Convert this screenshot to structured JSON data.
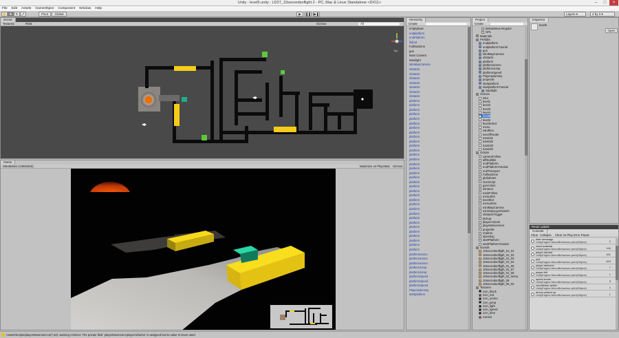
{
  "window": {
    "title": "Unity - level5.unity - LD27_10secondsoflight 2 - PC, Mac & Linux Standalone <DX11>"
  },
  "menu": [
    "File",
    "Edit",
    "Assets",
    "GameObject",
    "Component",
    "Window",
    "Help"
  ],
  "toolbar": {
    "pivot": "Pivot",
    "global": "Global",
    "layers": "Layers",
    "layout": "2 by 3"
  },
  "scene": {
    "tab": "Scene",
    "shading": "Textured",
    "mode": "RGB",
    "gizmos": "Gizmos",
    "search": "All",
    "persp": "Top"
  },
  "game": {
    "tab": "Game",
    "aspect": "Standalone (1360x816)",
    "maximize": "Maximize on Play",
    "stats": "Stats",
    "gizmos": "Gizmos"
  },
  "hierarchy": {
    "tab": "Hierarchy",
    "create": "Create",
    "items": [
      {
        "label": "emptyBase",
        "blue": false
      },
      {
        "label": "endplatform",
        "blue": true
      },
      {
        "label": "endPlatform",
        "blue": true
      },
      {
        "label": "fallout",
        "blue": true
      },
      {
        "label": "FallOutZone",
        "blue": false
      },
      {
        "label": "gun",
        "blue": false
      },
      {
        "label": "Main Camera",
        "blue": false
      },
      {
        "label": "Mainlight",
        "blue": false
      },
      {
        "label": "MiniMapCamera",
        "blue": true
      },
      {
        "label": "obstacle",
        "blue": true
      },
      {
        "label": "obstacle",
        "blue": true
      },
      {
        "label": "obstacle",
        "blue": true
      },
      {
        "label": "obstacle",
        "blue": true
      },
      {
        "label": "obstacle",
        "blue": true
      },
      {
        "label": "obstacle",
        "blue": true
      },
      {
        "label": "obstacle",
        "blue": true
      },
      {
        "label": "platform",
        "blue": true
      },
      {
        "label": "platform",
        "blue": true
      },
      {
        "label": "platform",
        "blue": true
      },
      {
        "label": "platform",
        "blue": true
      },
      {
        "label": "platform",
        "blue": true
      },
      {
        "label": "platform",
        "blue": true
      },
      {
        "label": "platform",
        "blue": true
      },
      {
        "label": "platform",
        "blue": true
      },
      {
        "label": "platform",
        "blue": true
      },
      {
        "label": "platform",
        "blue": true
      },
      {
        "label": "platform",
        "blue": true
      },
      {
        "label": "platform",
        "blue": true
      },
      {
        "label": "platform",
        "blue": true
      },
      {
        "label": "platform",
        "blue": true
      },
      {
        "label": "platform",
        "blue": true
      },
      {
        "label": "platform",
        "blue": true
      },
      {
        "label": "platform",
        "blue": true
      },
      {
        "label": "platform",
        "blue": true
      },
      {
        "label": "platform",
        "blue": true
      },
      {
        "label": "platform",
        "blue": true
      },
      {
        "label": "platform",
        "blue": true
      },
      {
        "label": "platform",
        "blue": true
      },
      {
        "label": "platform",
        "blue": true
      },
      {
        "label": "platform",
        "blue": true
      },
      {
        "label": "platform",
        "blue": true
      },
      {
        "label": "platform",
        "blue": true
      },
      {
        "label": "platform",
        "blue": true
      },
      {
        "label": "platform",
        "blue": true
      },
      {
        "label": "platform",
        "blue": true
      },
      {
        "label": "platform",
        "blue": true
      },
      {
        "label": "platform",
        "blue": true
      },
      {
        "label": "platform",
        "blue": true
      },
      {
        "label": "platform",
        "blue": true
      },
      {
        "label": "platform",
        "blue": true
      },
      {
        "label": "platformammo",
        "blue": true
      },
      {
        "label": "platformammo",
        "blue": true
      },
      {
        "label": "platformammo",
        "blue": true
      },
      {
        "label": "platformJump",
        "blue": true
      },
      {
        "label": "platformJump",
        "blue": true
      },
      {
        "label": "platformSpeed",
        "blue": true
      },
      {
        "label": "platformSpeed",
        "blue": true
      },
      {
        "label": "platformSpeed",
        "blue": true
      },
      {
        "label": "Player&dummy",
        "blue": true
      },
      {
        "label": "startplatform",
        "blue": true
      }
    ]
  },
  "project": {
    "tab": "Project",
    "create": "Create",
    "items": [
      {
        "label": "BebasNeue-Regular",
        "depth": 3,
        "icon": "font",
        "sel": false
      },
      {
        "label": "GPL",
        "depth": 3,
        "icon": "file",
        "sel": false
      },
      {
        "label": "Materials",
        "depth": 1,
        "icon": "folder",
        "sel": false
      },
      {
        "label": "Prefabs",
        "depth": 1,
        "icon": "folder",
        "sel": false
      },
      {
        "label": "endplatform",
        "depth": 2,
        "icon": "prefab",
        "sel": false
      },
      {
        "label": "endplatformTutorial",
        "depth": 2,
        "icon": "prefab",
        "sel": false
      },
      {
        "label": "gun",
        "depth": 2,
        "icon": "prefab",
        "sel": false
      },
      {
        "label": "MiniMapCamera",
        "depth": 2,
        "icon": "prefab",
        "sel": false
      },
      {
        "label": "obstacle",
        "depth": 2,
        "icon": "prefab",
        "sel": false
      },
      {
        "label": "platform",
        "depth": 2,
        "icon": "prefab",
        "sel": false
      },
      {
        "label": "platformammo",
        "depth": 2,
        "icon": "prefab",
        "sel": false
      },
      {
        "label": "platformJump",
        "depth": 2,
        "icon": "prefab",
        "sel": false
      },
      {
        "label": "platformSpeed",
        "depth": 2,
        "icon": "prefab",
        "sel": false
      },
      {
        "label": "Player&dummy",
        "depth": 2,
        "icon": "prefab",
        "sel": false
      },
      {
        "label": "projectile",
        "depth": 2,
        "icon": "prefab",
        "sel": false
      },
      {
        "label": "startplatform",
        "depth": 2,
        "icon": "prefab",
        "sel": false
      },
      {
        "label": "startplatformTutorial",
        "depth": 2,
        "icon": "prefab",
        "sel": false
      },
      {
        "label": "Spotlight",
        "depth": 3,
        "icon": "prefab",
        "sel": false
      },
      {
        "label": "Scenes",
        "depth": 1,
        "icon": "folder",
        "sel": false
      },
      {
        "label": "intro",
        "depth": 2,
        "icon": "unity",
        "sel": false
      },
      {
        "label": "level1",
        "depth": 2,
        "icon": "unity",
        "sel": false
      },
      {
        "label": "level2",
        "depth": 2,
        "icon": "unity",
        "sel": false
      },
      {
        "label": "level3",
        "depth": 2,
        "icon": "unity",
        "sel": false
      },
      {
        "label": "level4",
        "depth": 2,
        "icon": "unity",
        "sel": false
      },
      {
        "label": "level5",
        "depth": 2,
        "icon": "unity",
        "sel": true
      },
      {
        "label": "level6",
        "depth": 2,
        "icon": "unity",
        "sel": false
      },
      {
        "label": "levelSelect",
        "depth": 2,
        "icon": "unity",
        "sel": false
      },
      {
        "label": "menu",
        "depth": 2,
        "icon": "unity",
        "sel": false
      },
      {
        "label": "sandbox",
        "depth": 2,
        "icon": "unity",
        "sel": false
      },
      {
        "label": "sexOfRoutte",
        "depth": 2,
        "icon": "unity",
        "sel": false
      },
      {
        "label": "tutorial1",
        "depth": 2,
        "icon": "unity",
        "sel": false
      },
      {
        "label": "tutorial2",
        "depth": 2,
        "icon": "unity",
        "sel": false
      },
      {
        "label": "tutorial3",
        "depth": 2,
        "icon": "unity",
        "sel": false
      },
      {
        "label": "tutorial4",
        "depth": 2,
        "icon": "unity",
        "sel": false
      },
      {
        "label": "Scripts",
        "depth": 1,
        "icon": "folder",
        "sel": false
      },
      {
        "label": "cameraFollow",
        "depth": 2,
        "icon": "script",
        "sel": false
      },
      {
        "label": "diffSubtitle",
        "depth": 2,
        "icon": "script",
        "sel": false
      },
      {
        "label": "endPlatform",
        "depth": 2,
        "icon": "script",
        "sel": false
      },
      {
        "label": "endPlatformTutorial",
        "depth": 2,
        "icon": "script",
        "sel": false
      },
      {
        "label": "endTransport",
        "depth": 2,
        "icon": "script",
        "sel": false
      },
      {
        "label": "FalloutZone",
        "depth": 2,
        "icon": "script",
        "sel": false
      },
      {
        "label": "globalVars",
        "depth": 2,
        "icon": "script",
        "sel": false
      },
      {
        "label": "GUIScript",
        "depth": 2,
        "icon": "script",
        "sel": false
      },
      {
        "label": "gunAction",
        "depth": 2,
        "icon": "script",
        "sel": false
      },
      {
        "label": "introtext",
        "depth": 2,
        "icon": "script",
        "sel": false
      },
      {
        "label": "mainFollow",
        "depth": 2,
        "icon": "script",
        "sel": false
      },
      {
        "label": "menuSlot",
        "depth": 2,
        "icon": "script",
        "sel": false
      },
      {
        "label": "levelSlot",
        "depth": 2,
        "icon": "script",
        "sel": false
      },
      {
        "label": "menuSlot1",
        "depth": 2,
        "icon": "script",
        "sel": false
      },
      {
        "label": "miniMapCamera",
        "depth": 2,
        "icon": "script",
        "sel": false
      },
      {
        "label": "minimapLayerSwitch",
        "depth": 2,
        "icon": "script",
        "sel": false
      },
      {
        "label": "obstacleTrigger",
        "depth": 2,
        "icon": "script",
        "sel": false
      },
      {
        "label": "pickup",
        "depth": 2,
        "icon": "script",
        "sel": false
      },
      {
        "label": "playerActions",
        "depth": 2,
        "icon": "script",
        "sel": false
      },
      {
        "label": "playerMovement",
        "depth": 2,
        "icon": "script",
        "sel": false
      },
      {
        "label": "projectile",
        "depth": 2,
        "icon": "script",
        "sel": false
      },
      {
        "label": "readme",
        "depth": 2,
        "icon": "script",
        "sel": false
      },
      {
        "label": "speedUp",
        "depth": 2,
        "icon": "script",
        "sel": false
      },
      {
        "label": "startPlatform",
        "depth": 2,
        "icon": "script",
        "sel": false
      },
      {
        "label": "startPlatformTutorial",
        "depth": 2,
        "icon": "script",
        "sel": false
      },
      {
        "label": "sounds",
        "depth": 1,
        "icon": "folder",
        "sel": false
      },
      {
        "label": "10secondsofligth_01_01",
        "depth": 2,
        "icon": "audio",
        "sel": false
      },
      {
        "label": "10secondsofligth_01_02",
        "depth": 2,
        "icon": "audio",
        "sel": false
      },
      {
        "label": "10secondsofligth_01_03",
        "depth": 2,
        "icon": "audio",
        "sel": false
      },
      {
        "label": "10secondsofligth_01_04",
        "depth": 2,
        "icon": "audio",
        "sel": false
      },
      {
        "label": "10secondsofligth_01_05",
        "depth": 2,
        "icon": "audio",
        "sel": false
      },
      {
        "label": "10secondsofligth_01_07",
        "depth": 2,
        "icon": "audio",
        "sel": false
      },
      {
        "label": "10secondsofligth_01_08",
        "depth": 2,
        "icon": "audio",
        "sel": false
      },
      {
        "label": "10secondsofligth_02_menu",
        "depth": 2,
        "icon": "audio",
        "sel": false
      },
      {
        "label": "10secondsofligth_05",
        "depth": 2,
        "icon": "audio",
        "sel": false
      },
      {
        "label": "10secondsofligth_05_02",
        "depth": 2,
        "icon": "audio",
        "sel": false
      },
      {
        "label": "Textures",
        "depth": 1,
        "icon": "folder",
        "sel": false
      },
      {
        "label": "icon_black",
        "depth": 2,
        "icon": "tex-black",
        "sel": false
      },
      {
        "label": "icon_red",
        "depth": 2,
        "icon": "tex-red",
        "sel": false
      },
      {
        "label": "icon_ammo",
        "depth": 2,
        "icon": "tex-black",
        "sel": false
      },
      {
        "label": "icon_jump",
        "depth": 2,
        "icon": "tex-black",
        "sel": false
      },
      {
        "label": "icon_light",
        "depth": 2,
        "icon": "tex-black",
        "sel": false
      },
      {
        "label": "icon_speed",
        "depth": 2,
        "icon": "tex-black",
        "sel": false
      },
      {
        "label": "icon_time",
        "depth": 2,
        "icon": "tex-black",
        "sel": false
      },
      {
        "label": "Sunset",
        "depth": 2,
        "icon": "tex-sunset",
        "sel": false
      }
    ]
  },
  "inspector": {
    "tab": "Inspector",
    "object": "level5",
    "open": "Open"
  },
  "console": {
    "tab": "Console",
    "header": "Reset Labels",
    "buttons": [
      "Clear",
      "Collapse",
      "Clear on Play",
      "Error Pause"
    ],
    "rows": [
      {
        "l1": "start message",
        "l2": "UnityEngine.MonoBehaviour:print(Object)",
        "count": "2"
      },
      {
        "l1": "reset material",
        "l2": "UnityEngine.MonoBehaviour:print(Object)",
        "count": "134"
      },
      {
        "l1": "player landed",
        "l2": "UnityEngine.MonoBehaviour:print(Object)",
        "count": "441"
      },
      {
        "l1": "pull",
        "l2": "UnityEngine.MonoBehaviour:print(Object)",
        "count": "424"
      },
      {
        "l1": "player airborne",
        "l2": "UnityEngine.MonoBehaviour:print(Object)",
        "count": "7"
      },
      {
        "l1": "player fell",
        "l2": "UnityEngine.MonoBehaviour:print(Object)",
        "count": "1"
      },
      {
        "l1": "speed boost",
        "l2": "UnityEngine.MonoBehaviour:print(Object)",
        "count": "3"
      },
      {
        "l1": "countdown active",
        "l2": "UnityEngine.MonoBehaviour:print(Object)",
        "count": "1"
      },
      {
        "l1": "ammo picked up",
        "l2": "UnityEngine.MonoBehaviour:print(Object)",
        "count": "1"
      }
    ]
  },
  "status": {
    "text": "Assets/Scripts/playerMovement.cs(7,33): warning CS0414: The private field `playerMovement.playerAirborne' is assigned but its value is never used"
  },
  "colors": {
    "platform_yellow": "#f5cc19",
    "pickup_green": "#5cc93a",
    "pickup_teal": "#1fae8c",
    "glow_orange": "#e26a0a",
    "sunset": "#d2440c"
  }
}
